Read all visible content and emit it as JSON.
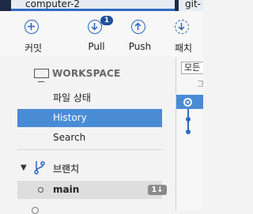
{
  "tabs": [
    {
      "label": "computer-2"
    },
    {
      "label": "git-"
    }
  ],
  "toolbar": {
    "commit_label": "커밋",
    "pull_label": "Pull",
    "pull_badge": "1",
    "push_label": "Push",
    "fetch_label": "패치"
  },
  "sidebar": {
    "workspace_label": "WORKSPACE",
    "items": [
      {
        "label": "파일 상태"
      },
      {
        "label": "History"
      },
      {
        "label": "Search"
      }
    ],
    "branches_label": "브랜치",
    "branch": {
      "name": "main",
      "count": "1↓"
    }
  },
  "right_pane": {
    "filter_value": "모든",
    "header_text": "그"
  },
  "colors": {
    "accent": "#2866bf",
    "selection": "#4a8bd6",
    "titlebar": "#1d2b47"
  }
}
